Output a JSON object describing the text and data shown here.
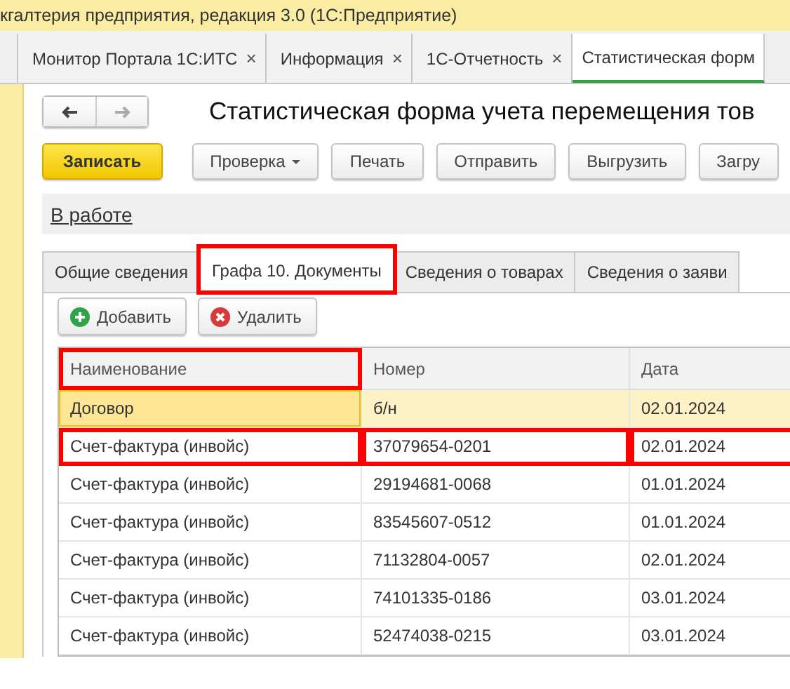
{
  "window": {
    "title": "кгалтерия предприятия, редакция 3.0  (1С:Предприятие)"
  },
  "open_tabs": [
    {
      "label": "Монитор Портала 1С:ИТС",
      "selected": false,
      "close": "×"
    },
    {
      "label": "Информация",
      "selected": false,
      "close": "×"
    },
    {
      "label": "1С-Отчетность",
      "selected": false,
      "close": "×"
    },
    {
      "label": "Статистическая форм",
      "selected": true
    }
  ],
  "form": {
    "title": "Статистическая форма учета перемещения тов",
    "toolbar": [
      {
        "label": "Записать",
        "kind": "primary"
      },
      {
        "label": "Проверка",
        "kind": "dropdown"
      },
      {
        "label": "Печать",
        "kind": "plain"
      },
      {
        "label": "Отправить",
        "kind": "plain"
      },
      {
        "label": "Выгрузить",
        "kind": "plain"
      },
      {
        "label": "Загру",
        "kind": "plain"
      }
    ],
    "status_link": "В работе",
    "sections": [
      {
        "label": "Общие сведения",
        "selected": false,
        "highlighted": false
      },
      {
        "label": "Графа 10. Документы",
        "selected": true,
        "highlighted": true
      },
      {
        "label": "Сведения о товарах",
        "selected": false,
        "highlighted": false
      },
      {
        "label": "Сведения о заяви",
        "selected": false,
        "highlighted": false
      }
    ],
    "table_toolbar": [
      {
        "label": "Добавить",
        "kind": "add"
      },
      {
        "label": "Удалить",
        "kind": "delete"
      }
    ],
    "table": {
      "columns": [
        {
          "label": "Наименование",
          "highlighted": true
        },
        {
          "label": "Номер",
          "highlighted": false
        },
        {
          "label": "Дата",
          "highlighted": false
        }
      ],
      "rows": [
        {
          "selected": true,
          "cells": [
            {
              "text": "Договор",
              "highlighted": false
            },
            {
              "text": "б/н",
              "highlighted": false
            },
            {
              "text": "02.01.2024",
              "highlighted": false
            }
          ]
        },
        {
          "selected": false,
          "cells": [
            {
              "text": "Счет-фактура (инвойс)",
              "highlighted": true
            },
            {
              "text": "37079654-0201",
              "highlighted": true
            },
            {
              "text": "02.01.2024",
              "highlighted": true
            }
          ]
        },
        {
          "selected": false,
          "cells": [
            {
              "text": "Счет-фактура (инвойс)",
              "highlighted": false
            },
            {
              "text": "29194681-0068",
              "highlighted": false
            },
            {
              "text": "01.01.2024",
              "highlighted": false
            }
          ]
        },
        {
          "selected": false,
          "cells": [
            {
              "text": "Счет-фактура (инвойс)",
              "highlighted": false
            },
            {
              "text": "83545607-0512",
              "highlighted": false
            },
            {
              "text": "01.01.2024",
              "highlighted": false
            }
          ]
        },
        {
          "selected": false,
          "cells": [
            {
              "text": "Счет-фактура (инвойс)",
              "highlighted": false
            },
            {
              "text": "71132804-0057",
              "highlighted": false
            },
            {
              "text": "02.01.2024",
              "highlighted": false
            }
          ]
        },
        {
          "selected": false,
          "cells": [
            {
              "text": "Счет-фактура (инвойс)",
              "highlighted": false
            },
            {
              "text": "74101335-0186",
              "highlighted": false
            },
            {
              "text": "03.01.2024",
              "highlighted": false
            }
          ]
        },
        {
          "selected": false,
          "cells": [
            {
              "text": "Счет-фактура (инвойс)",
              "highlighted": false
            },
            {
              "text": "52474038-0215",
              "highlighted": false
            },
            {
              "text": "03.01.2024",
              "highlighted": false
            }
          ]
        }
      ]
    }
  }
}
